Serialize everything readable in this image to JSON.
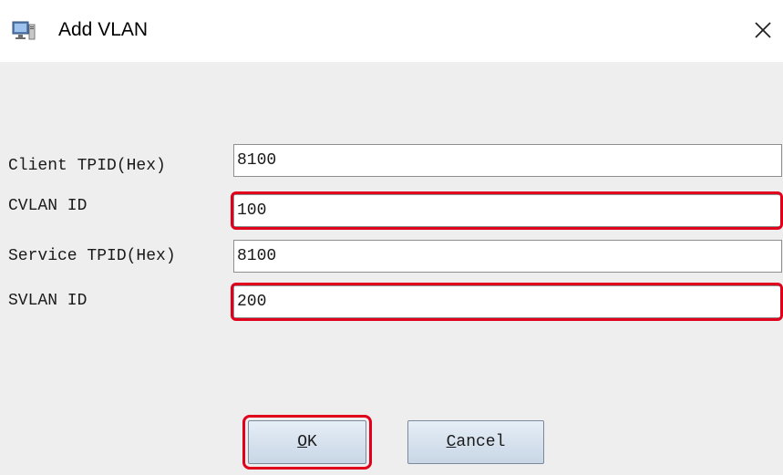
{
  "window": {
    "title": "Add VLAN",
    "icon": "network-computer-icon",
    "close_icon": "close-icon"
  },
  "form": {
    "fields": [
      {
        "label": "Client TPID(Hex)",
        "value": "8100",
        "highlighted": false
      },
      {
        "label": "CVLAN ID",
        "value": "100",
        "highlighted": true
      },
      {
        "label": "Service TPID(Hex)",
        "value": "8100",
        "highlighted": false
      },
      {
        "label": "SVLAN ID",
        "value": "200",
        "highlighted": true
      }
    ]
  },
  "buttons": {
    "ok": {
      "mnemonic": "O",
      "rest": "K",
      "highlighted": true
    },
    "cancel": {
      "mnemonic": "C",
      "rest": "ancel",
      "highlighted": false
    }
  },
  "colors": {
    "highlight": "#e0001b",
    "content_bg": "#eeeeee",
    "field_border": "#8e8e8e"
  }
}
